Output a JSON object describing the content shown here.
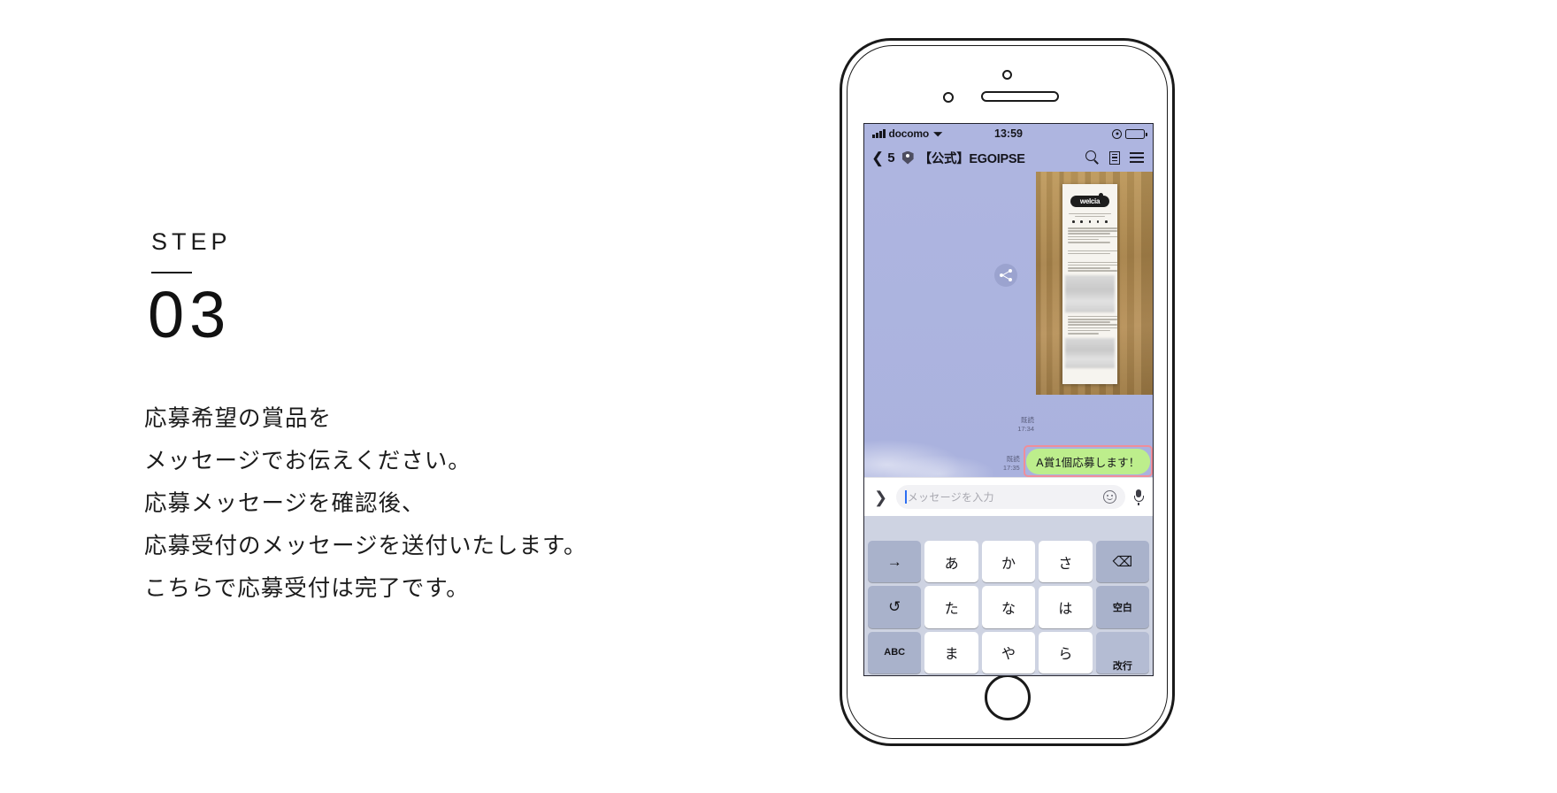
{
  "left_panel": {
    "step_label": "STEP",
    "step_number": "03",
    "description_lines": [
      "応募希望の賞品を",
      "メッセージでお伝えください。",
      "応募メッセージを確認後、",
      "応募受付のメッセージを送付いたします。",
      "こちらで応募受付は完了です。"
    ]
  },
  "phone": {
    "status_bar": {
      "carrier": "docomo",
      "wifi_icon": "wifi-icon",
      "time": "13:59",
      "alarm_icon": "alarm-icon",
      "battery_icon": "battery-icon"
    },
    "chat_header": {
      "back_icon": "chevron-left-icon",
      "unread_count": "5",
      "verified_icon": "verified-badge-icon",
      "title": "【公式】EGOIPSE",
      "actions": [
        {
          "name": "search-icon",
          "label": "search"
        },
        {
          "name": "notes-icon",
          "label": "notes"
        },
        {
          "name": "menu-icon",
          "label": "menu"
        }
      ]
    },
    "chat_body": {
      "share_icon": "share-icon",
      "photo": {
        "brand": "welcia",
        "alt": "receipt-photo"
      },
      "photo_read_status": "既読",
      "photo_time": "17:34",
      "message_read_status": "既読",
      "message_time": "17:35",
      "message_text": "A賞1個応募します！",
      "highlight_color": "#ef8e9a",
      "bubble_color": "#bdee8c",
      "background_color": "#aeb5e0"
    },
    "input_bar": {
      "expand_icon": "chevron-right-icon",
      "placeholder": "メッセージを入力",
      "emoji_icon": "emoji-icon",
      "mic_icon": "microphone-icon"
    },
    "keyboard": {
      "rows": [
        [
          {
            "label": "→",
            "type": "func",
            "name": "key-arrow-right"
          },
          {
            "label": "あ",
            "type": "kana",
            "name": "key-a"
          },
          {
            "label": "か",
            "type": "kana",
            "name": "key-ka"
          },
          {
            "label": "さ",
            "type": "kana",
            "name": "key-sa"
          },
          {
            "label": "⌫",
            "type": "func",
            "name": "key-backspace"
          }
        ],
        [
          {
            "label": "↺",
            "type": "func",
            "name": "key-undo"
          },
          {
            "label": "た",
            "type": "kana",
            "name": "key-ta"
          },
          {
            "label": "な",
            "type": "kana",
            "name": "key-na"
          },
          {
            "label": "は",
            "type": "kana",
            "name": "key-ha"
          },
          {
            "label": "空白",
            "type": "func",
            "name": "key-space"
          }
        ],
        [
          {
            "label": "ABC",
            "type": "func",
            "name": "key-abc"
          },
          {
            "label": "ま",
            "type": "kana",
            "name": "key-ma"
          },
          {
            "label": "や",
            "type": "kana",
            "name": "key-ya"
          },
          {
            "label": "ら",
            "type": "kana",
            "name": "key-ra"
          },
          {
            "label": "改行",
            "type": "func",
            "name": "key-newline"
          }
        ]
      ]
    }
  }
}
